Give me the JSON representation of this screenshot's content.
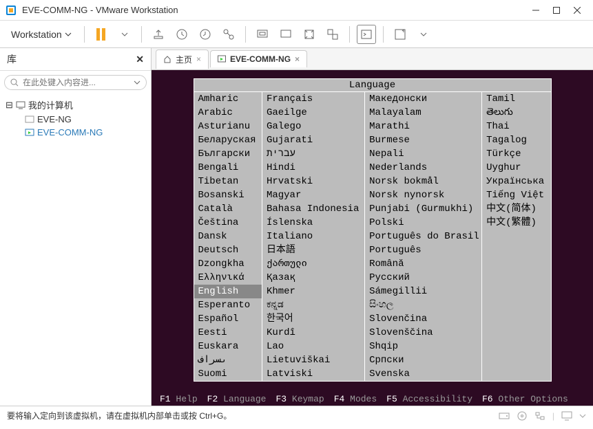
{
  "window": {
    "title": "EVE-COMM-NG - VMware Workstation"
  },
  "menu": {
    "workstation": "Workstation"
  },
  "sidebar": {
    "title": "库",
    "search_placeholder": "在此处键入内容进...",
    "root": "我的计算机",
    "children": [
      "EVE-NG",
      "EVE-COMM-NG"
    ]
  },
  "tabs": {
    "home": "主页",
    "vm": "EVE-COMM-NG"
  },
  "installer": {
    "header": "Language",
    "columns": [
      [
        "Amharic",
        "Arabic",
        "Asturianu",
        "Беларуская",
        "Български",
        "Bengali",
        "Tibetan",
        "Bosanski",
        "Català",
        "Čeština",
        "Dansk",
        "Deutsch",
        "Dzongkha",
        "Ελληνικά",
        "English",
        "Esperanto",
        "Español",
        "Eesti",
        "Euskara",
        "ىسراف",
        "Suomi"
      ],
      [
        "Français",
        "Gaeilge",
        "Galego",
        "Gujarati",
        "עברית",
        "Hindi",
        "Hrvatski",
        "Magyar",
        "Bahasa Indonesia",
        "Íslenska",
        "Italiano",
        "日本語",
        "ქართული",
        "Қазақ",
        "Khmer",
        "ಕನ್ನಡ",
        "한국어",
        "Kurdî",
        "Lao",
        "Lietuviškai",
        "Latviski"
      ],
      [
        "Македонски",
        "Malayalam",
        "Marathi",
        "Burmese",
        "Nepali",
        "Nederlands",
        "Norsk bokmål",
        "Norsk nynorsk",
        "Punjabi (Gurmukhi)",
        "Polski",
        "Português do Brasil",
        "Português",
        "Română",
        "Русский",
        "Sámegillii",
        "සිංහල",
        "Slovenčina",
        "Slovenščina",
        "Shqip",
        "Српски",
        "Svenska"
      ],
      [
        "Tamil",
        "తెలుగు",
        "Thai",
        "Tagalog",
        "Türkçe",
        "Uyghur",
        "Українська",
        "Tiếng Việt",
        "中文(简体)",
        "中文(繁體)"
      ]
    ],
    "selected": "English",
    "fkeys": {
      "f1": "Help",
      "f2": "Language",
      "f3": "Keymap",
      "f4": "Modes",
      "f5": "Accessibility",
      "f6": "Other Options"
    }
  },
  "statusbar": {
    "hint": "要将输入定向到该虚拟机，请在虚拟机内部单击或按 Ctrl+G。"
  }
}
